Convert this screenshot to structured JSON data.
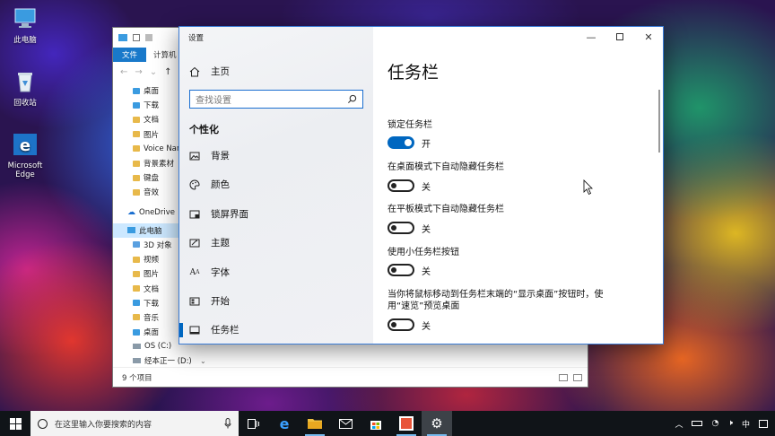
{
  "desktop": {
    "icons": [
      {
        "label": "此电脑"
      },
      {
        "label": "回收站"
      },
      {
        "label": "Microsoft Edge"
      }
    ]
  },
  "explorer": {
    "ribbon_file": "文件",
    "ribbon_computer": "计算机",
    "tree": [
      "桌面",
      "下载",
      "文档",
      "图片",
      "Voice Narr",
      "背景素材",
      "键盘",
      "音效",
      "OneDrive",
      "此电脑",
      "3D 对象",
      "视频",
      "图片",
      "文档",
      "下载",
      "音乐",
      "桌面",
      "OS (C:)",
      "经本正一 (D:)"
    ],
    "status": "9 个项目"
  },
  "settings": {
    "window_title": "设置",
    "home_label": "主页",
    "search_placeholder": "查找设置",
    "section_title": "个性化",
    "nav": [
      {
        "label": "背景",
        "icon": "picture-icon"
      },
      {
        "label": "颜色",
        "icon": "palette-icon"
      },
      {
        "label": "锁屏界面",
        "icon": "lockscreen-icon"
      },
      {
        "label": "主题",
        "icon": "theme-icon"
      },
      {
        "label": "字体",
        "icon": "font-icon"
      },
      {
        "label": "开始",
        "icon": "start-icon"
      },
      {
        "label": "任务栏",
        "icon": "taskbar-icon"
      }
    ],
    "active_nav": "任务栏",
    "page_title": "任务栏",
    "options": [
      {
        "label": "锁定任务栏",
        "state": "开",
        "on": true
      },
      {
        "label": "在桌面模式下自动隐藏任务栏",
        "state": "关",
        "on": false
      },
      {
        "label": "在平板模式下自动隐藏任务栏",
        "state": "关",
        "on": false
      },
      {
        "label": "使用小任务栏按钮",
        "state": "关",
        "on": false
      },
      {
        "label": "当你将鼠标移动到任务栏末端的“显示桌面”按钮时，使用“速览”预览桌面",
        "state": "关",
        "on": false
      }
    ]
  },
  "taskbar": {
    "search_placeholder": "在这里输入你要搜索的内容",
    "ime": "中"
  },
  "colors": {
    "accent": "#0067c0",
    "taskbar": "#101418"
  }
}
